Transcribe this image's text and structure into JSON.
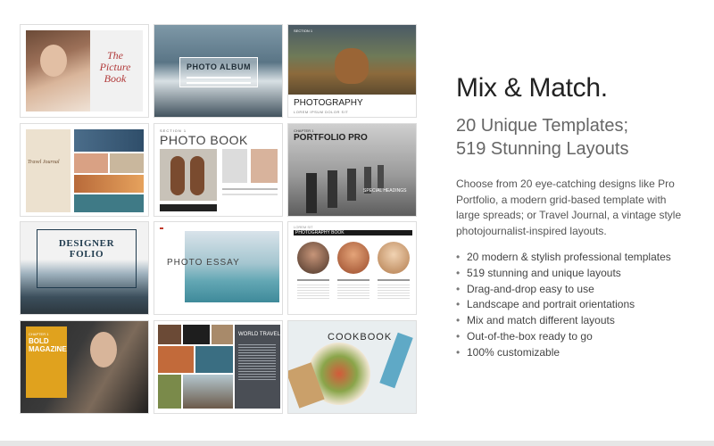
{
  "thumbnails": {
    "picture_book": {
      "title": "The Picture Book"
    },
    "photo_album": {
      "title": "PHOTO ALBUM"
    },
    "photography": {
      "section": "SECTION 1",
      "title": "PHOTOGRAPHY",
      "sub": "LOREM IPSUM DOLOR SIT"
    },
    "travel_journal": {
      "title": "Travel Journal"
    },
    "photo_book": {
      "section": "SECTION 1",
      "title": "PHOTO BOOK"
    },
    "portfolio_pro": {
      "section": "CHAPTER 1",
      "title": "PORTFOLIO PRO",
      "caption": "SPECIAL HEADINGS"
    },
    "designer_folio": {
      "title": "DESIGNER FOLIO"
    },
    "photo_essay": {
      "title": "PHOTO ESSAY"
    },
    "photography_book": {
      "kicker": "LOREM SIT",
      "title": "PHOTOGRAPHY BOOK"
    },
    "bold_magazine": {
      "chapter": "CHAPTER 1",
      "title": "BOLD MAGAZINE"
    },
    "world_travel": {
      "title": "WORLD TRAVEL"
    },
    "cookbook": {
      "title": "COOKBOOK"
    }
  },
  "copy": {
    "headline": "Mix & Match.",
    "subhead_line1": "20 Unique Templates;",
    "subhead_line2": "519 Stunning Layouts",
    "description": "Choose from 20 eye-catching designs like Pro Portfolio, a modern grid-based template with large spreads; or Travel Journal, a vintage style photojournalist-inspired layouts.",
    "bullets": [
      "20 modern & stylish professional templates",
      "519 stunning and unique layouts",
      "Drag-and-drop easy to use",
      "Landscape and portrait orientations",
      "Mix and match different layouts",
      "Out-of-the-box ready to go",
      "100% customizable"
    ]
  },
  "colors": {
    "accent_red": "#c0392b",
    "dark_navy": "#1f3a4d",
    "gold": "#e0a21e"
  }
}
